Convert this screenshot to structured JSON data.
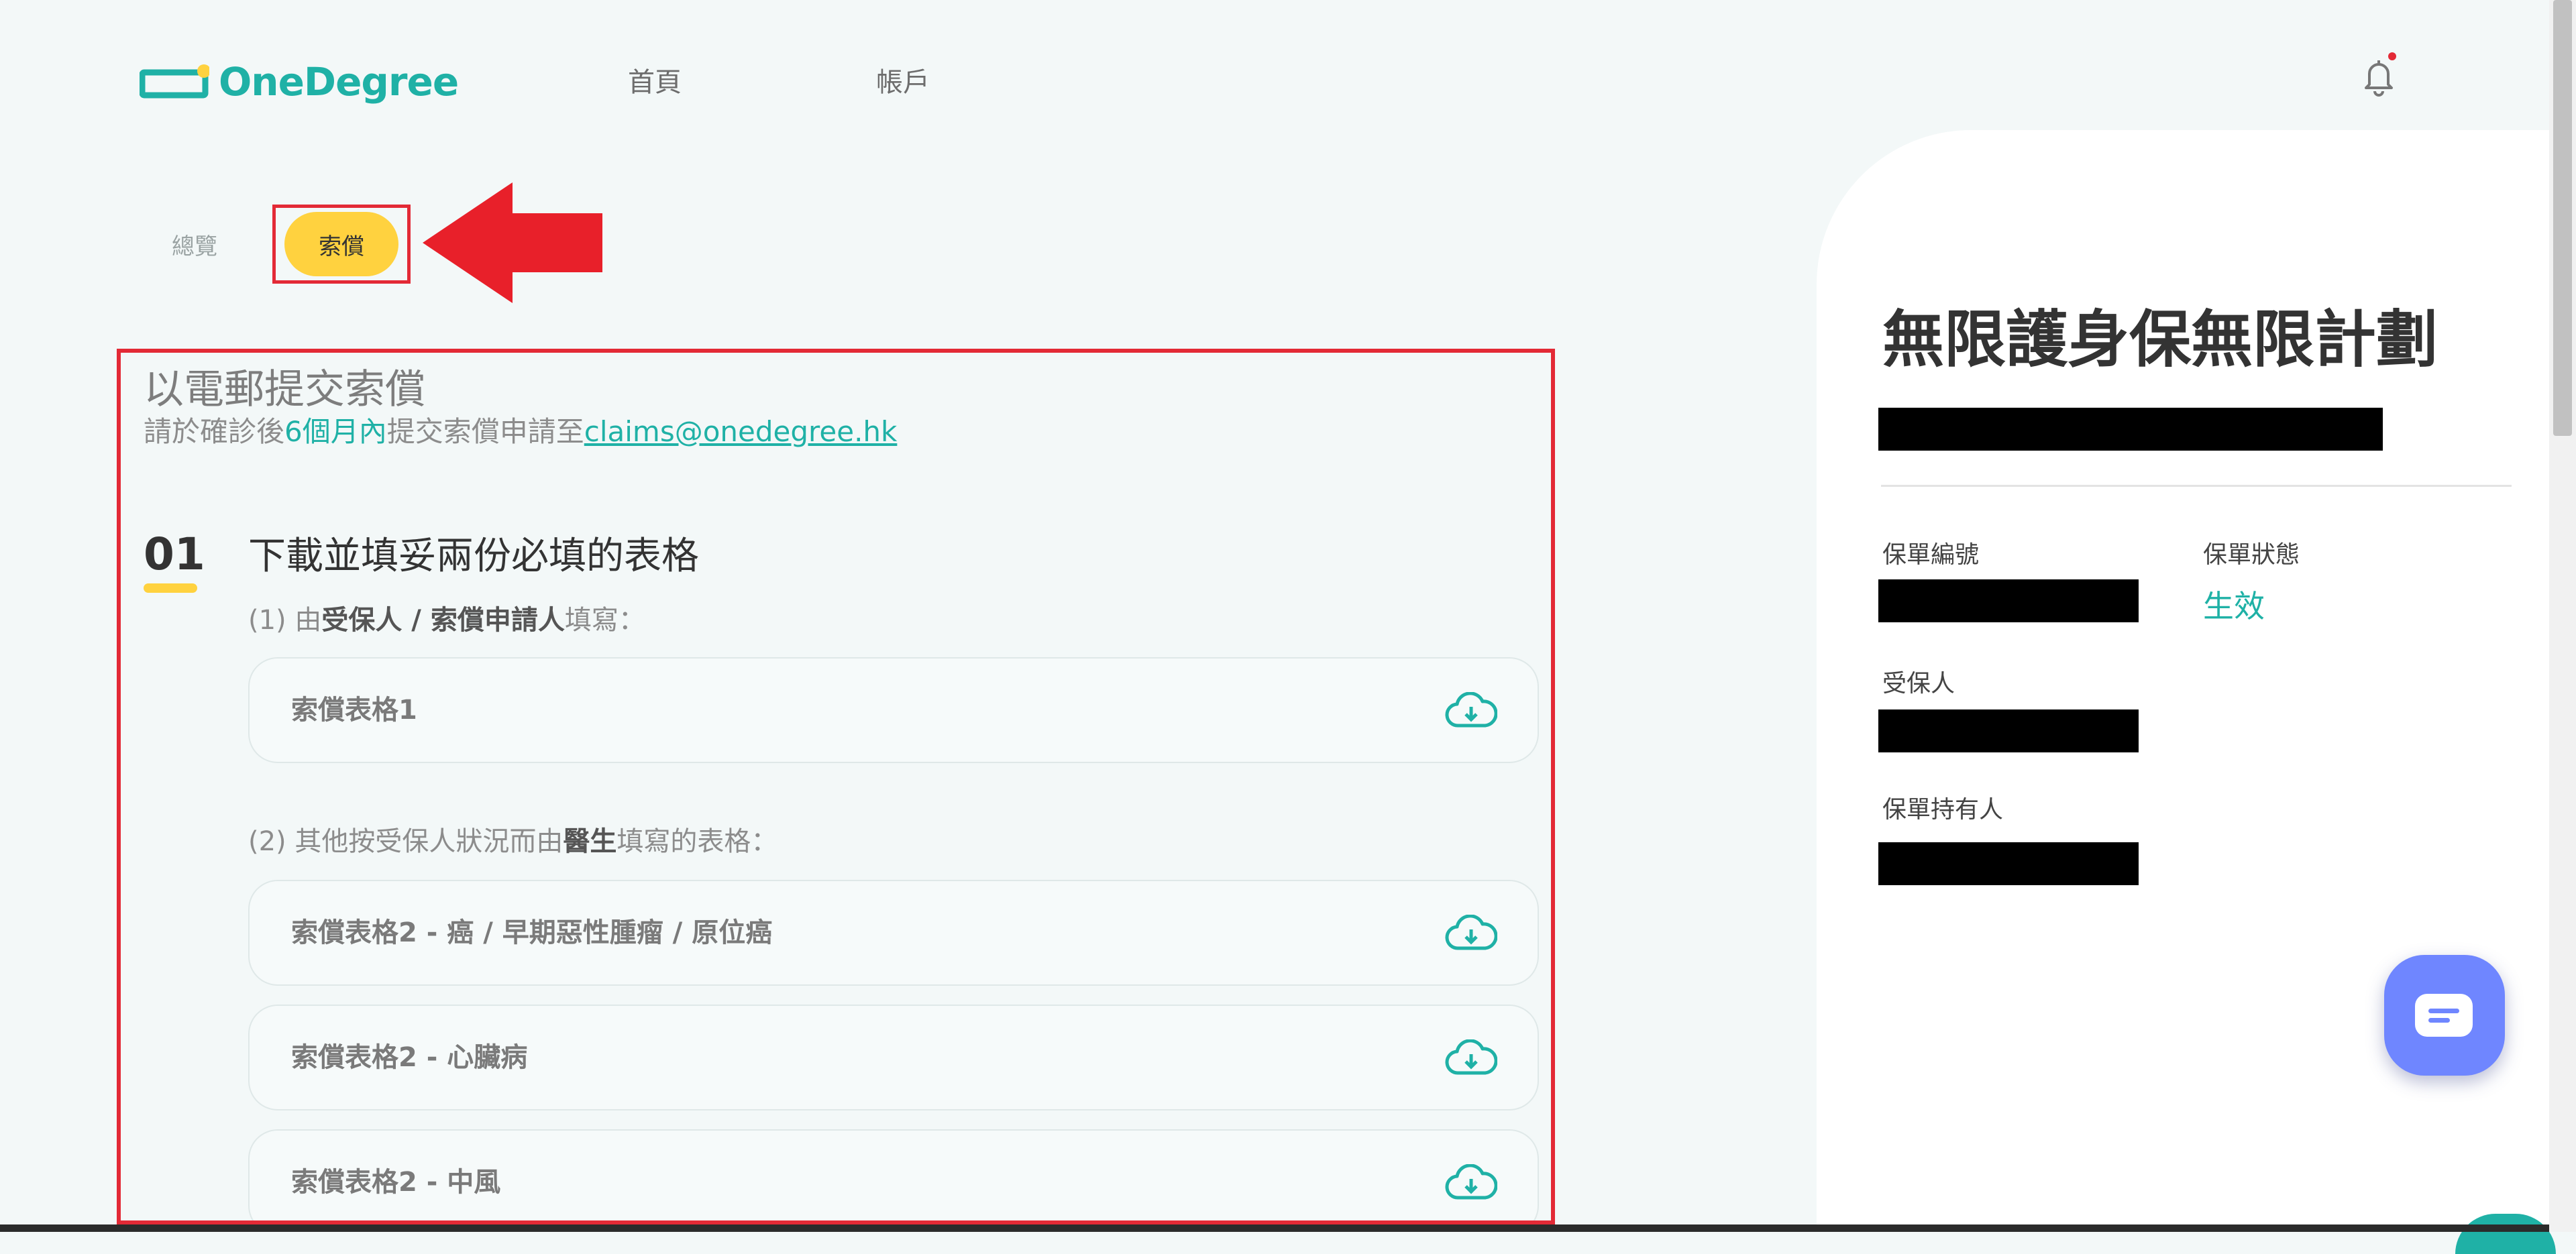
{
  "header": {
    "logo_text": "OneDegree",
    "nav": [
      "首頁",
      "帳戶"
    ]
  },
  "tabs": {
    "overview": "總覽",
    "claims": "索償"
  },
  "claim_section": {
    "title": "以電郵提交索償",
    "subtitle_pre": "請於確診後",
    "subtitle_highlight": "6個月內",
    "subtitle_mid": "提交索償申請至",
    "email": "claims@onedegree.hk",
    "step_number": "01",
    "step_title": "下載並填妥兩份必填的表格",
    "note1": {
      "a": "(1) 由",
      "b": "受保人 / 索償申請人",
      "c": "填寫："
    },
    "note2": {
      "a": "(2) 其他按受保人狀況而由",
      "b": "醫生",
      "c": "填寫的表格："
    },
    "forms": [
      "索償表格1",
      "索償表格2 - 癌 / 早期惡性腫瘤 / 原位癌",
      "索償表格2 - 心臟病",
      "索償表格2 - 中風"
    ]
  },
  "policy": {
    "plan_name": "無限護身保無限計劃",
    "policy_number_label": "保單編號",
    "policy_status_label": "保單狀態",
    "policy_status_value": "生效",
    "insured_label": "受保人",
    "holder_label": "保單持有人"
  },
  "colors": {
    "brand": "#1fb1a6",
    "accent_yellow": "#ffd23f",
    "highlight_red": "#e32a36",
    "chat_blue": "#6f86ff"
  }
}
